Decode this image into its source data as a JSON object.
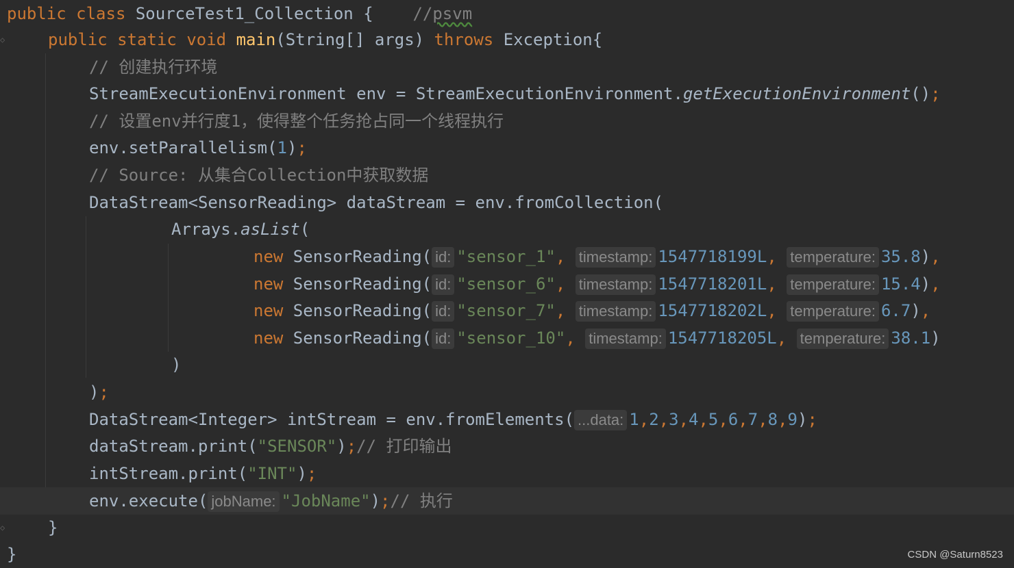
{
  "editor": {
    "colors": {
      "background": "#2b2b2b",
      "keyword": "#cc7832",
      "method_decl": "#ffc66d",
      "string": "#6a8759",
      "number": "#6897bb",
      "comment": "#808080",
      "plain": "#a9b7c6",
      "hint_bg": "#3b3b3b",
      "current_line": "#323232"
    },
    "lines": {
      "l1": {
        "public": "public",
        "class": "class",
        "name": " SourceTest1_Collection {    ",
        "comment_slashes": "//",
        "comment_text": "psvm"
      },
      "l2": {
        "public": "public",
        "static": "static",
        "void": "void",
        "main": "main",
        "params": "(String[] args) ",
        "throws": "throws",
        "exception": " Exception{"
      },
      "l3": {
        "comment": "// 创建执行环境"
      },
      "l4": {
        "decl": "StreamExecutionEnvironment env = StreamExecutionEnvironment.",
        "method": "getExecutionEnvironment",
        "call_end": "()",
        "semi": ";"
      },
      "l5": {
        "comment": "// 设置env并行度1，使得整个任务抢占同一个线程执行"
      },
      "l6": {
        "call": "env.setParallelism(",
        "arg": "1",
        "close": ")",
        "semi": ";"
      },
      "l7": {
        "comment": "// Source: 从集合Collection中获取数据"
      },
      "l8": {
        "decl": "DataStream<SensorReading> dataStream = env.fromCollection("
      },
      "l9": {
        "cls": "Arrays.",
        "method": "asList",
        "open": "("
      },
      "sensor_rows": [
        {
          "new": "new",
          "ctor": " SensorReading(",
          "hint_id": "id:",
          "id": "\"sensor_1\"",
          "comma1": ", ",
          "hint_ts": "timestamp:",
          "ts": "1547718199L",
          "comma2": ", ",
          "hint_temp": "temperature:",
          "temp": "35.8",
          "close": ")",
          "comma3": ","
        },
        {
          "new": "new",
          "ctor": " SensorReading(",
          "hint_id": "id:",
          "id": "\"sensor_6\"",
          "comma1": ", ",
          "hint_ts": "timestamp:",
          "ts": "1547718201L",
          "comma2": ", ",
          "hint_temp": "temperature:",
          "temp": "15.4",
          "close": ")",
          "comma3": ","
        },
        {
          "new": "new",
          "ctor": " SensorReading(",
          "hint_id": "id:",
          "id": "\"sensor_7\"",
          "comma1": ", ",
          "hint_ts": "timestamp:",
          "ts": "1547718202L",
          "comma2": ", ",
          "hint_temp": "temperature:",
          "temp": "6.7",
          "close": ")",
          "comma3": ","
        },
        {
          "new": "new",
          "ctor": " SensorReading(",
          "hint_id": "id:",
          "id": "\"sensor_10\"",
          "comma1": ", ",
          "hint_ts": "timestamp:",
          "ts": "1547718205L",
          "comma2": ", ",
          "hint_temp": "temperature:",
          "temp": "38.1",
          "close": ")",
          "comma3": ""
        }
      ],
      "l14": {
        "close": ")"
      },
      "l15": {
        "close": ")",
        "semi": ";"
      },
      "l16": {
        "decl": "DataStream<Integer> intStream = env.fromElements(",
        "hint": "...data:",
        "n1": "1",
        "n2": "2",
        "n3": "3",
        "n4": "4",
        "n5": "5",
        "n6": "6",
        "n7": "7",
        "n8": "8",
        "n9": "9",
        "comma": ",",
        "close": ")",
        "semi": ";"
      },
      "l17": {
        "call": "dataStream.print(",
        "arg": "\"SENSOR\"",
        "close": ")",
        "semi": ";",
        "comment": "// 打印输出"
      },
      "l18": {
        "call": "intStream.print(",
        "arg": "\"INT\"",
        "close": ")",
        "semi": ";"
      },
      "l19": {
        "call": "env.execute(",
        "hint": "jobName:",
        "arg": "\"JobName\"",
        "close": ")",
        "semi": ";",
        "comment": "// 执行"
      },
      "l20": {
        "close": "}"
      },
      "l21": {
        "close": "}"
      }
    }
  },
  "watermark": "CSDN @Saturn8523"
}
